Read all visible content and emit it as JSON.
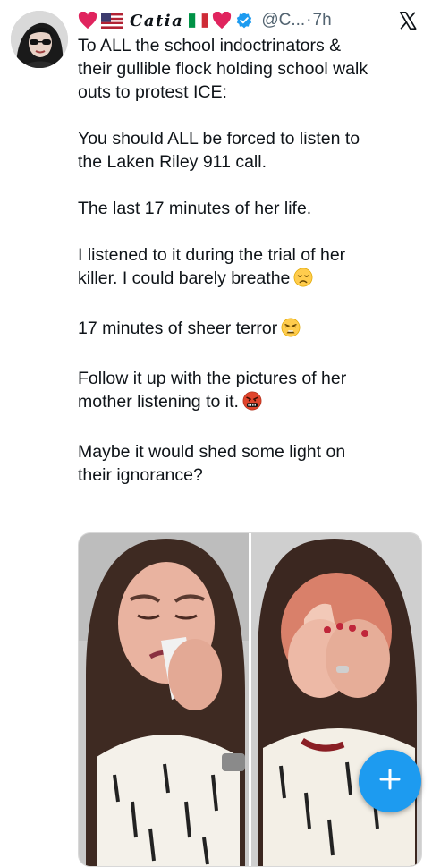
{
  "post": {
    "author": {
      "display_name": "Catia",
      "handle": "@C...",
      "separator": "·",
      "time": "7h"
    },
    "text_lines": [
      "To ALL the school indoctrinators &",
      "their gullible flock holding school walk",
      "outs to protest ICE:",
      "You should ALL be forced to listen to",
      "the Laken Riley 911 call.",
      "The last 17 minutes of her life.",
      "I listened to it during the trial of her",
      "killer. I could barely breathe",
      "17 minutes of sheer terror",
      "Follow it up with the pictures of her",
      "mother listening to it.",
      "Maybe it would shed some light on",
      "their ignorance?"
    ]
  },
  "media": {
    "panels": 2,
    "subject": "woman crying holding tissue"
  },
  "icons": {
    "header": [
      "heart-icon",
      "us-flag-icon",
      "italy-flag-icon",
      "heart-icon",
      "verified-badge-icon",
      "x-logo-icon"
    ],
    "emoji": [
      "disappointed-face-icon",
      "weary-face-icon",
      "cursing-face-icon"
    ],
    "fab": "plus-icon"
  },
  "colors": {
    "accent": "#1d9bf0",
    "heart": "#e0245e",
    "secondary_text": "#536471"
  }
}
